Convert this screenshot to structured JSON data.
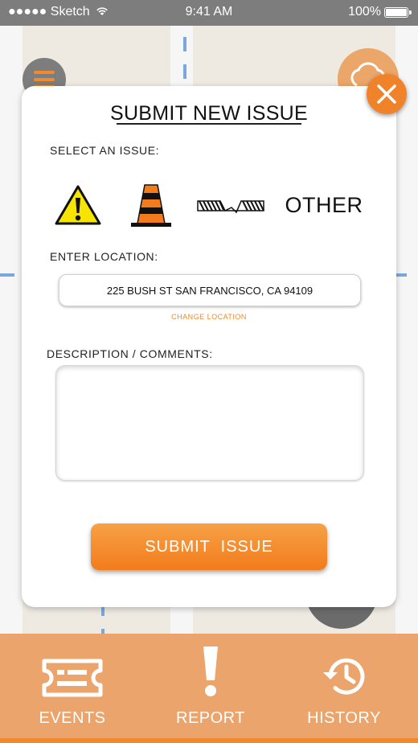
{
  "status_bar": {
    "carrier": "●●●●● Sketch",
    "time": "9:41 AM",
    "battery": "100%"
  },
  "modal": {
    "title": "SUBMIT NEW ISSUE",
    "select_issue_label": "SELECT AN ISSUE:",
    "issue_types": [
      {
        "name": "hazard",
        "icon": "warning-icon"
      },
      {
        "name": "construction",
        "icon": "traffic-cone-icon"
      },
      {
        "name": "road damage",
        "icon": "pothole-icon"
      },
      {
        "label": "OTHER"
      }
    ],
    "location_label": "ENTER LOCATION:",
    "location_value": "225 BUSH ST SAN FRANCISCO, CA 94109",
    "change_location": "CHANGE LOCATION",
    "comments_label": "DESCRIPTION / COMMENTS:",
    "comments_value": "",
    "submit_label": "SUBMIT  ISSUE"
  },
  "tab_bar": {
    "tabs": [
      {
        "label": "EVENTS",
        "icon": "ticket-icon"
      },
      {
        "label": "REPORT",
        "icon": "exclamation-icon"
      },
      {
        "label": "HISTORY",
        "icon": "history-icon"
      }
    ]
  },
  "colors": {
    "accent": "#f08a2c",
    "tab_bar": "#eba46b",
    "status_bar": "#7d7d7d"
  }
}
